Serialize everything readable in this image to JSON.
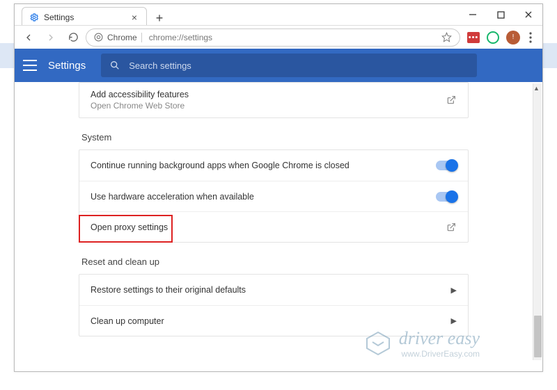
{
  "window": {
    "tab_title": "Settings",
    "origin_label": "Chrome",
    "url_display": "chrome://settings"
  },
  "header": {
    "title": "Settings",
    "search_placeholder": "Search settings"
  },
  "accessibility": {
    "title": "Add accessibility features",
    "subtitle": "Open Chrome Web Store"
  },
  "system": {
    "heading": "System",
    "rows": [
      {
        "label": "Continue running background apps when Google Chrome is closed",
        "toggle": true
      },
      {
        "label": "Use hardware acceleration when available",
        "toggle": true
      },
      {
        "label": "Open proxy settings"
      }
    ]
  },
  "reset": {
    "heading": "Reset and clean up",
    "rows": [
      {
        "label": "Restore settings to their original defaults"
      },
      {
        "label": "Clean up computer"
      }
    ]
  },
  "watermark": {
    "line1": "driver easy",
    "line2": "www.DriverEasy.com"
  }
}
